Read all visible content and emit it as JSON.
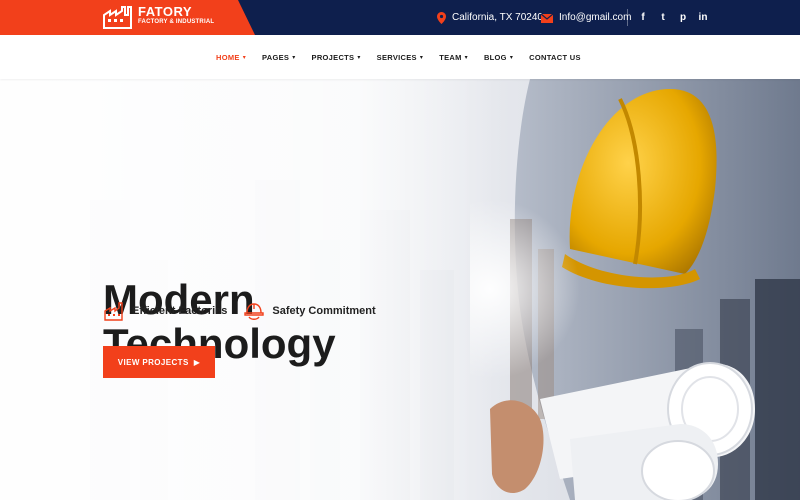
{
  "brand": {
    "name": "FATORY",
    "tagline": "FACTORY & INDUSTRIAL",
    "accent": "#f2401b",
    "topbar_bg": "#0e1f4d"
  },
  "topbar": {
    "location": "California, TX 70240",
    "email": "Info@gmail.com",
    "socials": [
      {
        "label": "f",
        "icon": "facebook-icon"
      },
      {
        "label": "t",
        "icon": "twitter-icon"
      },
      {
        "label": "p",
        "icon": "pinterest-icon"
      },
      {
        "label": "in",
        "icon": "linkedin-icon"
      }
    ]
  },
  "nav": {
    "items": [
      {
        "label": "HOME",
        "active": true
      },
      {
        "label": "PAGES"
      },
      {
        "label": "PROJECTS"
      },
      {
        "label": "SERVICES"
      },
      {
        "label": "TEAM"
      },
      {
        "label": "BLOG"
      },
      {
        "label": "CONTACT US"
      }
    ]
  },
  "hero": {
    "title_line1": "Modern",
    "title_line2": "Technology",
    "features": [
      {
        "label": "Efficient Factories",
        "icon": "factory-icon"
      },
      {
        "label": "Safety Commitment",
        "icon": "hard-hat-icon"
      }
    ],
    "cta": "VIEW PROJECTS"
  }
}
